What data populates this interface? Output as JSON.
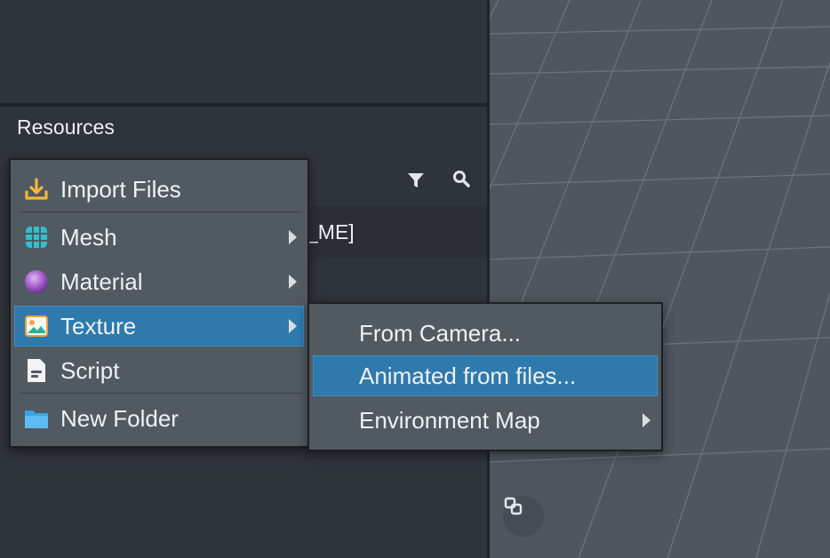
{
  "resources_panel": {
    "title": "Resources",
    "partial_item_text": "_ME]",
    "filter_icon": "filter-icon",
    "search_icon": "search-icon"
  },
  "context_menu": {
    "items": [
      {
        "label": "Import Files",
        "icon": "download-icon",
        "submenu": false
      },
      {
        "label": "Mesh",
        "icon": "grid-icon",
        "submenu": true
      },
      {
        "label": "Material",
        "icon": "sphere-icon",
        "submenu": true
      },
      {
        "label": "Texture",
        "icon": "image-icon",
        "submenu": true,
        "selected": true
      },
      {
        "label": "Script",
        "icon": "script-icon",
        "submenu": false
      },
      {
        "label": "New Folder",
        "icon": "folder-icon",
        "submenu": false
      }
    ]
  },
  "texture_submenu": {
    "items": [
      {
        "label": "From Camera...",
        "submenu": false
      },
      {
        "label": "Animated from files...",
        "submenu": false,
        "selected": true
      },
      {
        "label": "Environment Map",
        "submenu": true
      }
    ]
  },
  "colors": {
    "selection": "#2e7aad",
    "menu_background": "#525a61",
    "panel_background": "#2f333a",
    "viewport_background": "#4f565e"
  },
  "viewport": {
    "button_icon": "view-toggle-icon"
  }
}
